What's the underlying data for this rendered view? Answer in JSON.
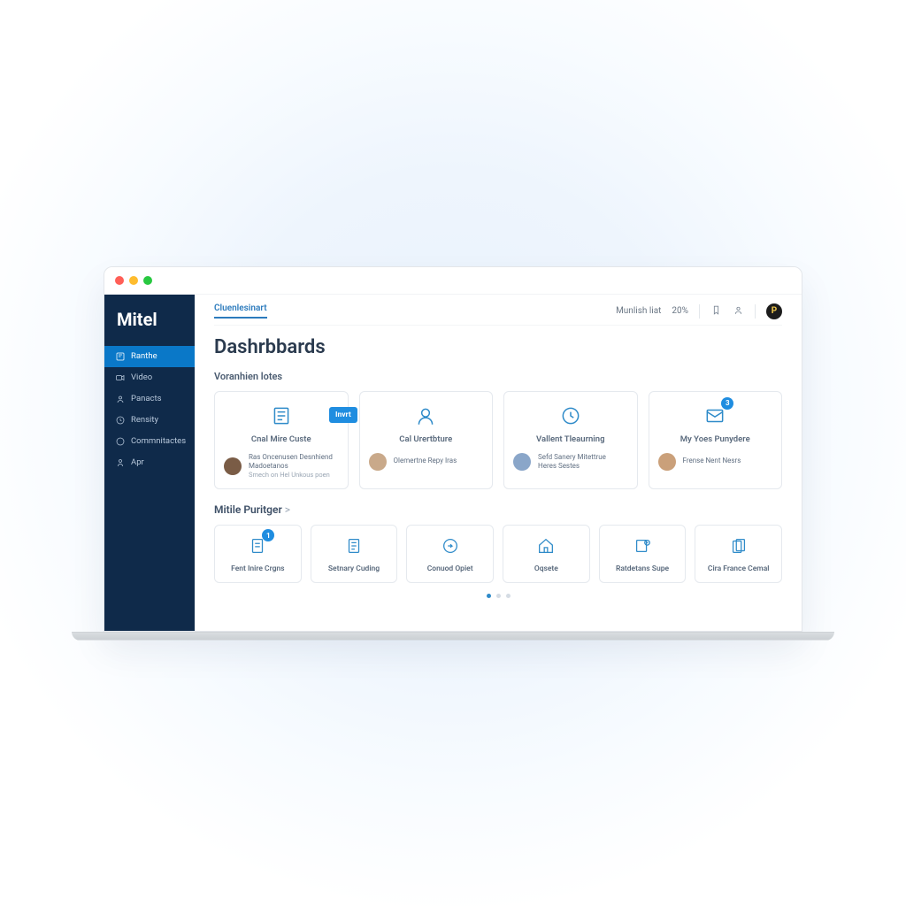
{
  "brand": "Mitel",
  "sidebar": {
    "items": [
      {
        "label": "Ranthe"
      },
      {
        "label": "Video"
      },
      {
        "label": "Panacts"
      },
      {
        "label": "Rensity"
      },
      {
        "label": "Commnitactes"
      },
      {
        "label": "Apr"
      }
    ]
  },
  "topbar": {
    "tab": "Cluenlesinart",
    "status": "Munlish liat",
    "time": "20%",
    "avatar_initial": "P"
  },
  "page": {
    "title": "Dashrbbards",
    "section1_label": "Voranhien lotes",
    "chip": "Invrt",
    "section2_label": "Mitile Puritger",
    "section2_chevron": ">"
  },
  "cards": [
    {
      "title": "Cnal Mire Custe",
      "meta_line1": "Ras Oncenusen Desnhiend",
      "meta_line2": "Madoetanos",
      "meta_sub": "Smech on Hel Unkous poen"
    },
    {
      "title": "Cal Urertbture",
      "meta_line1": "Olemertne Repy Iras",
      "meta_line2": "",
      "meta_sub": ""
    },
    {
      "title": "Vallent Tleaurning",
      "meta_line1": "Sefd Sanery Mitettrue",
      "meta_line2": "Heres Sestes",
      "meta_sub": ""
    },
    {
      "title": "My Yoes Punydere",
      "meta_line1": "Frense Nent Nesrs",
      "meta_line2": "",
      "meta_sub": "",
      "badge": "3"
    }
  ],
  "tiles": [
    {
      "label": "Fent Inire Crgns",
      "badge": "1"
    },
    {
      "label": "Setnary Cuding"
    },
    {
      "label": "Conuod Opiet"
    },
    {
      "label": "Oqsete"
    },
    {
      "label": "Ratdetans Supe"
    },
    {
      "label": "Cira France Cemal"
    }
  ]
}
